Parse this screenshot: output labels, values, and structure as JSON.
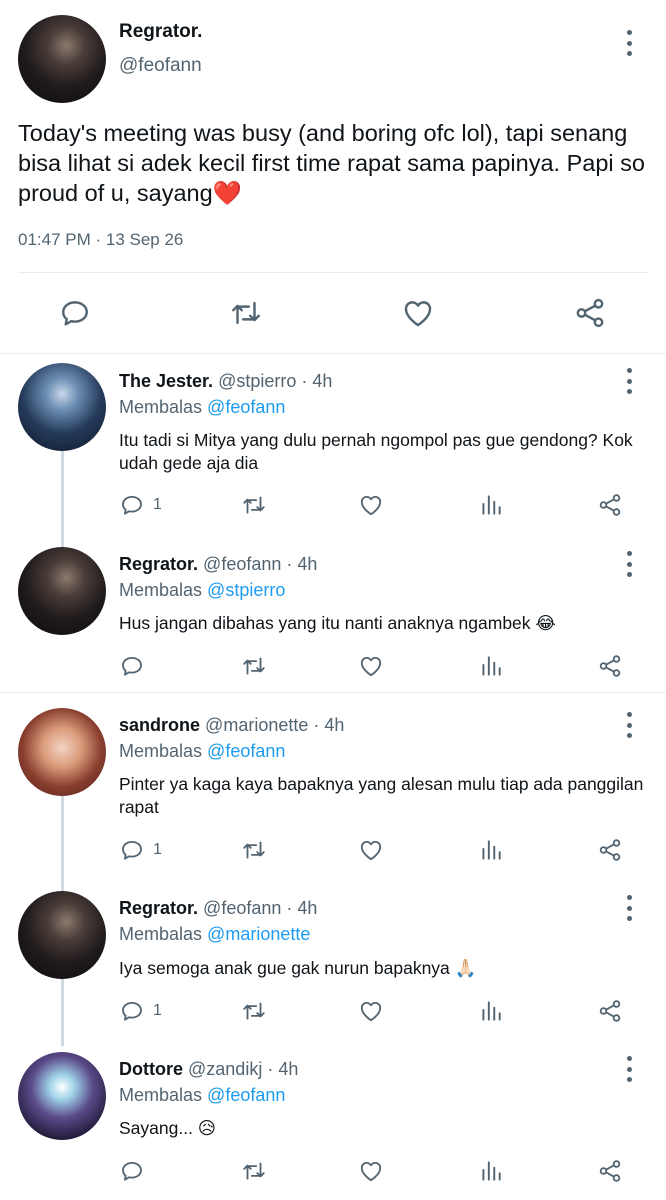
{
  "main_tweet": {
    "author_name": "Regrator.",
    "author_handle": "@feofann",
    "text": "Today's meeting was busy (and boring ofc lol), tapi senang bisa lihat si adek kecil first time rapat sama papinya. Papi so proud of u, sayang❤️",
    "timestamp": "01:47 PM · 13 Sep 26",
    "icons": [
      "reply-icon",
      "retweet-icon",
      "like-icon",
      "share-icon"
    ]
  },
  "replies": [
    {
      "name": "The Jester.",
      "handle": "@stpierro",
      "time": "· 4h",
      "reply_prefix": "Membalas",
      "reply_to": "@feofann",
      "text": "Itu tadi si Mitya yang dulu pernah ngompol pas gue gendong? Kok udah gede aja dia",
      "reply_count": "1"
    },
    {
      "name": "Regrator.",
      "handle": "@feofann",
      "time": "· 4h",
      "reply_prefix": "Membalas",
      "reply_to": "@stpierro",
      "text": "Hus jangan dibahas yang itu nanti anaknya ngambek 😂",
      "reply_count": ""
    },
    {
      "name": "sandrone",
      "handle": "@marionette",
      "time": "· 4h",
      "reply_prefix": "Membalas",
      "reply_to": "@feofann",
      "text": "Pinter ya kaga kaya bapaknya yang alesan mulu tiap ada panggilan rapat",
      "reply_count": "1"
    },
    {
      "name": "Regrator.",
      "handle": "@feofann",
      "time": "· 4h",
      "reply_prefix": "Membalas",
      "reply_to": "@marionette",
      "text": "Iya semoga anak gue gak nurun bapaknya 🙏🏻",
      "reply_count": "1"
    },
    {
      "name": "Dottore",
      "handle": "@zandikj",
      "time": "· 4h",
      "reply_prefix": "Membalas",
      "reply_to": "@feofann",
      "text": "Sayang... 😥",
      "reply_count": ""
    }
  ],
  "colors": {
    "text": "#0f1419",
    "secondary": "#536471",
    "link": "#1d9bf0",
    "divider": "#e6ecf0",
    "thread_line": "#cfd9de"
  }
}
